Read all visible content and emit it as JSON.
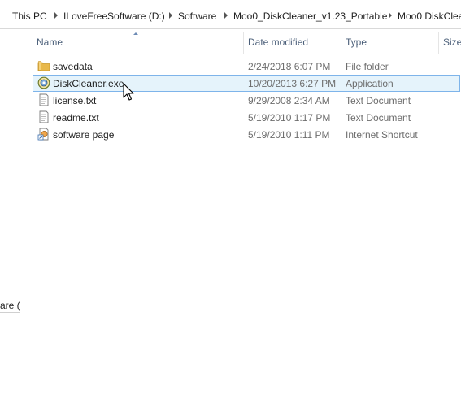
{
  "address_bar": {
    "crumbs": [
      "This PC",
      "ILoveFreeSoftware (D:)",
      "Software",
      "Moo0_DiskCleaner_v1.23_Portable",
      "Moo0 DiskClea"
    ]
  },
  "nav_pane": {
    "fragment_text": "are (D"
  },
  "columns": {
    "name": "Name",
    "date": "Date modified",
    "type": "Type",
    "size": "Size"
  },
  "files": [
    {
      "name": "savedata",
      "date": "2/24/2018 6:07 PM",
      "type": "File folder",
      "icon": "folder-icon",
      "selected": false
    },
    {
      "name": "DiskCleaner.exe",
      "date": "10/20/2013 6:27 PM",
      "type": "Application",
      "icon": "application-icon",
      "selected": true
    },
    {
      "name": "license.txt",
      "date": "9/29/2008 2:34 AM",
      "type": "Text Document",
      "icon": "text-document-icon",
      "selected": false
    },
    {
      "name": "readme.txt",
      "date": "5/19/2010 1:17 PM",
      "type": "Text Document",
      "icon": "text-document-icon",
      "selected": false
    },
    {
      "name": "software page",
      "date": "5/19/2010 1:11 PM",
      "type": "Internet Shortcut",
      "icon": "internet-shortcut-icon",
      "selected": false
    }
  ],
  "colors": {
    "selection_fill": "#e5f3fb",
    "selection_border": "#7eb4ea",
    "header_text": "#4c607a",
    "folder_yellow": "#e8b84a"
  }
}
